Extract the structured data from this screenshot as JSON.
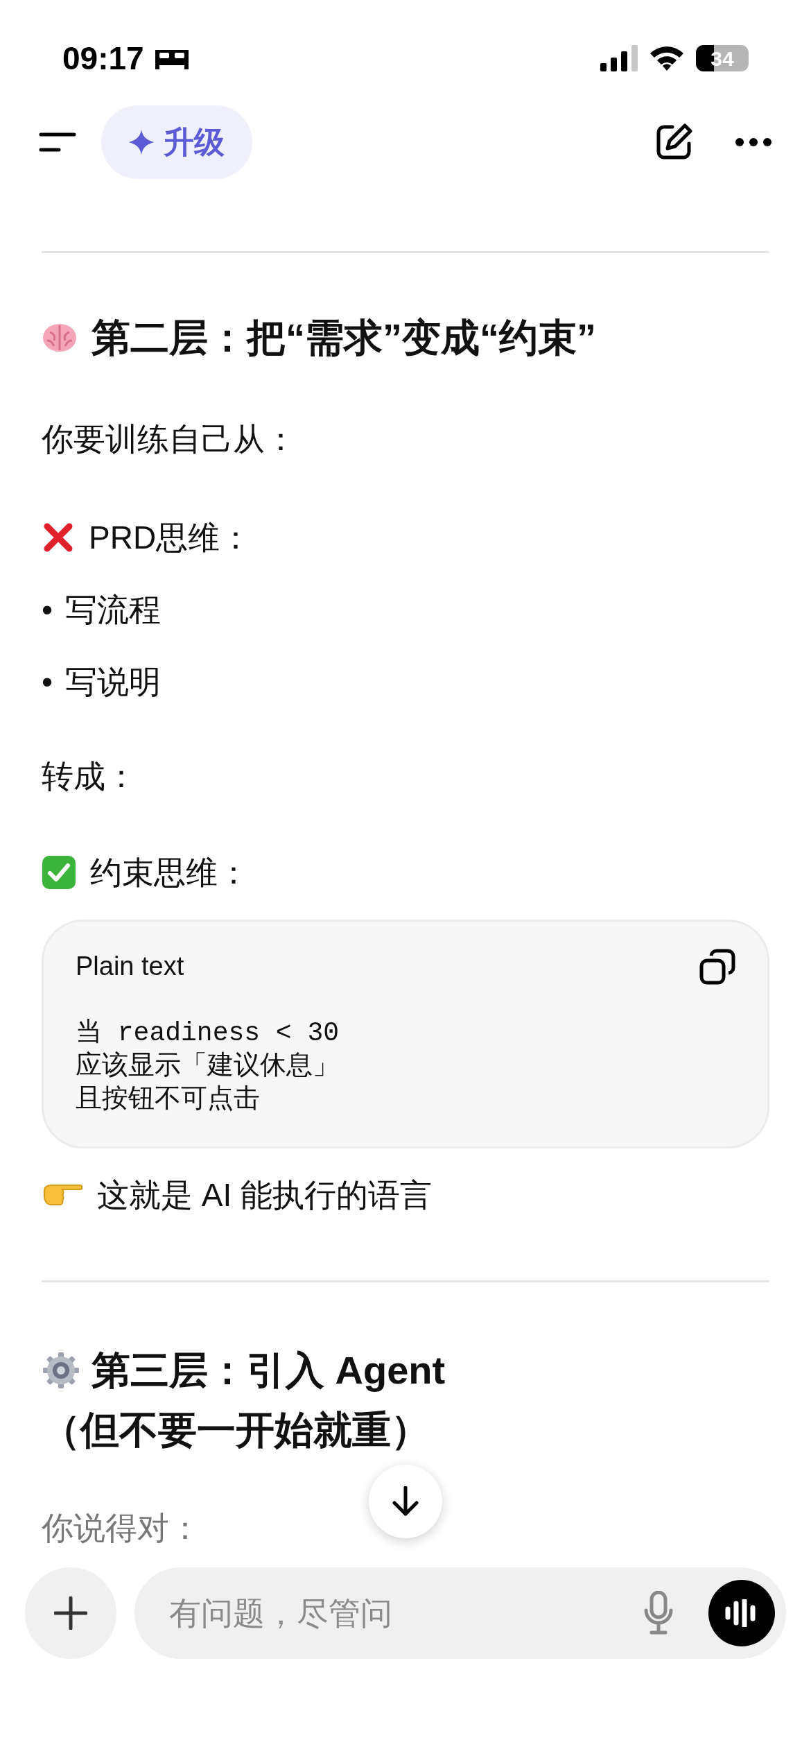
{
  "status_bar": {
    "time": "09:17",
    "battery": "34"
  },
  "nav": {
    "upgrade_label": "升级"
  },
  "layer2": {
    "title": "第二层：把“需求”变成“约束”",
    "intro": "你要训练自己从：",
    "wrong": {
      "label": "PRD思维：",
      "bullets": [
        {
          "marker": "•",
          "text": "写流程"
        },
        {
          "marker": "•",
          "text": "写说明"
        }
      ]
    },
    "transition": "转成：",
    "right": {
      "label": "约束思维："
    },
    "code": {
      "language": "Plain text",
      "lines": [
        "当 readiness < 30",
        "应该显示「建议休息」",
        "且按钮不可点击"
      ]
    },
    "note": "这就是 AI 能执行的语言"
  },
  "layer3": {
    "title_lines": [
      "第三层：引入 Agent",
      "（但不要一开始就重）"
    ],
    "intro": "你说得对："
  },
  "composer": {
    "placeholder": "有问题，尽管问"
  }
}
